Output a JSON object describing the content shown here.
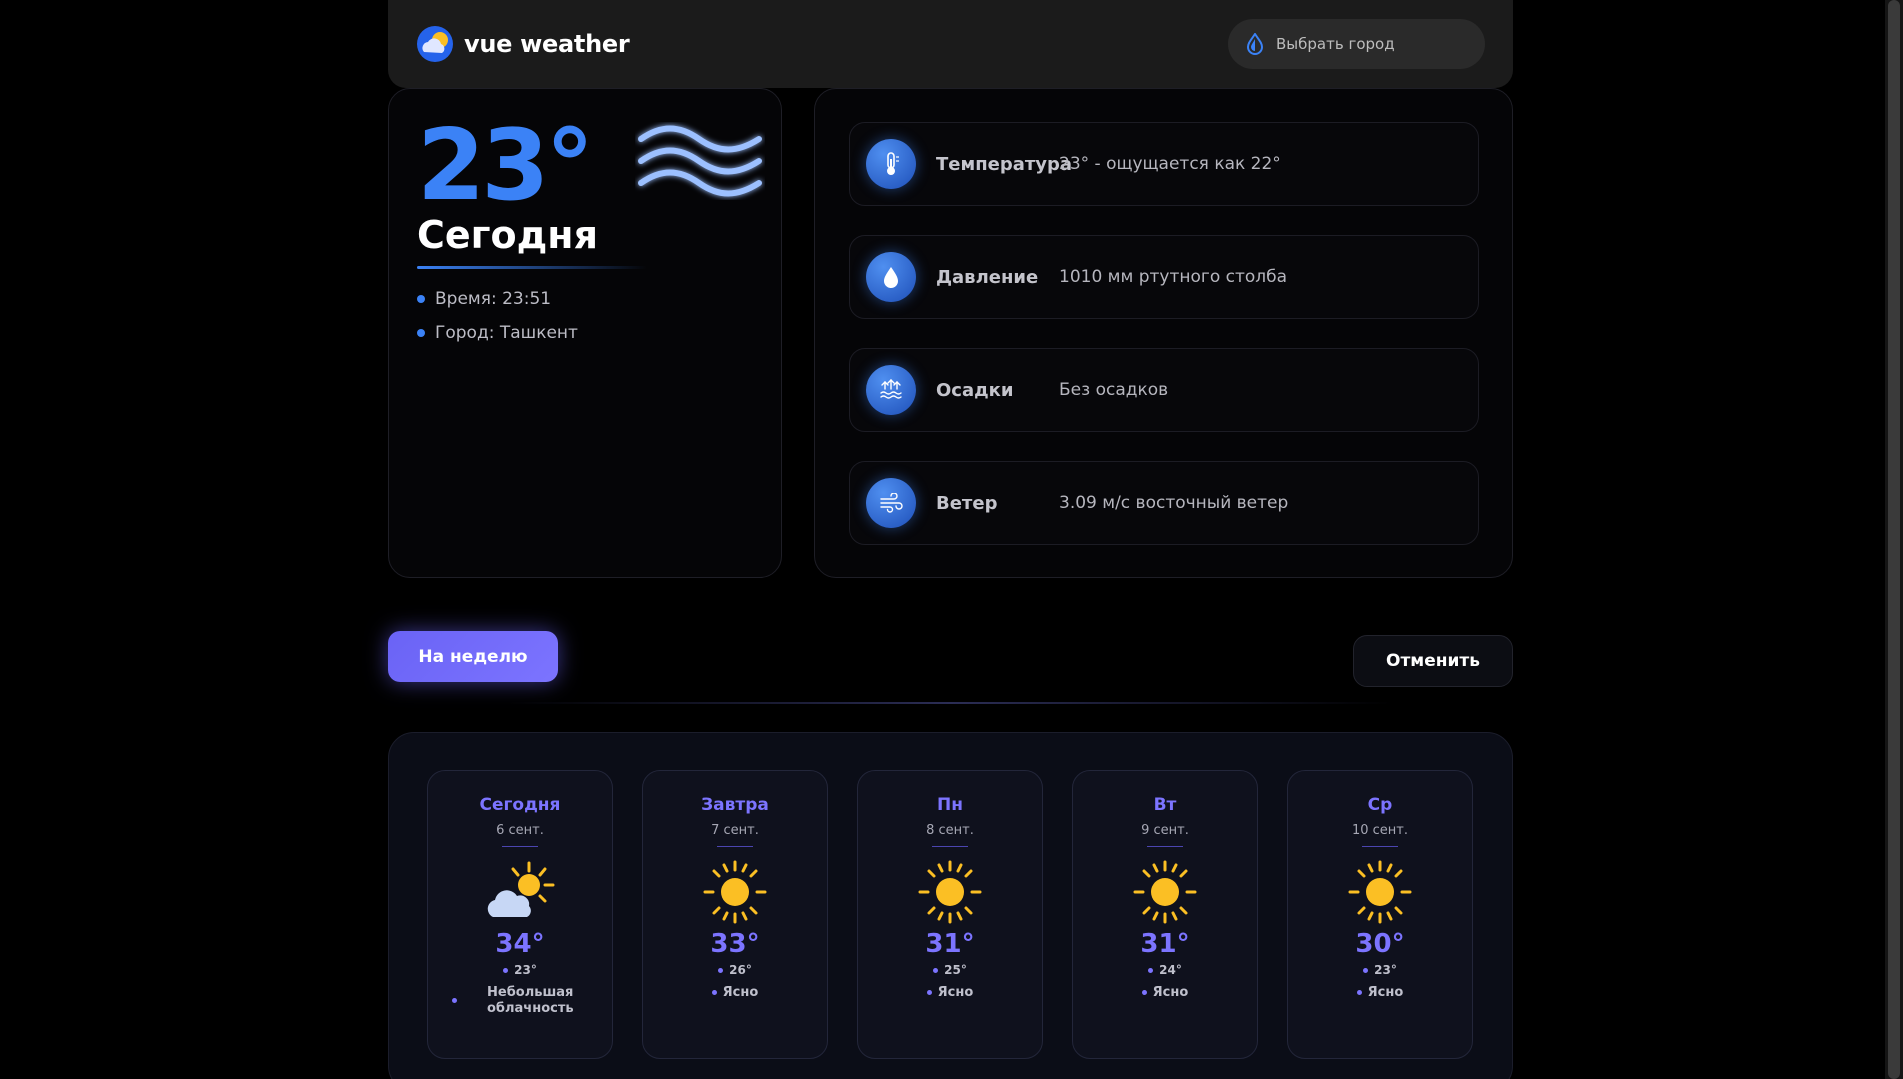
{
  "header": {
    "brand": "vue weather",
    "city_placeholder": "Выбрать город"
  },
  "current": {
    "temperature": "23°",
    "day_label": "Сегодня",
    "time": "Время: 23:51",
    "city": "Город: Ташкент"
  },
  "details": [
    {
      "label": "Температура",
      "value": "23° - ощущается как 22°",
      "icon": "thermometer-icon"
    },
    {
      "label": "Давление",
      "value": "1010 мм ртутного столба",
      "icon": "water-drop-icon"
    },
    {
      "label": "Осадки",
      "value": "Без осадков",
      "icon": "precipitation-icon"
    },
    {
      "label": "Ветер",
      "value": "3.09 м/с восточный ветер",
      "icon": "wind-icon"
    }
  ],
  "actions": {
    "week_label": "На неделю",
    "cancel_label": "Отменить"
  },
  "forecast": [
    {
      "day": "Сегодня",
      "date": "6 сент.",
      "high": "34°",
      "low": "23°",
      "desc": "Небольшая облачность",
      "icon": "partly-cloudy-icon"
    },
    {
      "day": "Завтра",
      "date": "7 сент.",
      "high": "33°",
      "low": "26°",
      "desc": "Ясно",
      "icon": "sun-icon"
    },
    {
      "day": "Пн",
      "date": "8 сент.",
      "high": "31°",
      "low": "25°",
      "desc": "Ясно",
      "icon": "sun-icon"
    },
    {
      "day": "Вт",
      "date": "9 сент.",
      "high": "31°",
      "low": "24°",
      "desc": "Ясно",
      "icon": "sun-icon"
    },
    {
      "day": "Ср",
      "date": "10 сент.",
      "high": "30°",
      "low": "23°",
      "desc": "Ясно",
      "icon": "sun-icon"
    }
  ],
  "colors": {
    "accent_blue": "#3b82f6",
    "accent_purple": "#7c74ff",
    "sun_yellow": "#fbbf24"
  }
}
